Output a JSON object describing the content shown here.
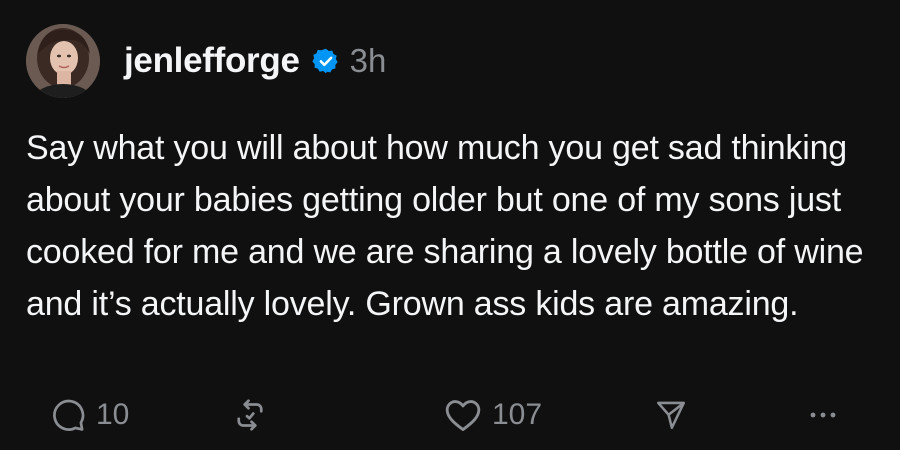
{
  "post": {
    "username": "jenlefforge",
    "timestamp": "3h",
    "verified": true,
    "text": "Say what you will about how much you get sad thinking about your babies getting older but one of my sons just cooked for me and we are sharing a lovely bottle of wine and it’s actually lovely. Grown ass kids are amazing.",
    "actions": {
      "reply_count": "10",
      "like_count": "107"
    }
  },
  "icons": {
    "avatar": "profile-photo",
    "verified": "verified-badge-icon",
    "reply": "comment-bubble-icon",
    "repost": "repost-arrows-icon",
    "like": "heart-icon",
    "share": "paper-plane-icon",
    "more": "ellipsis-icon"
  },
  "colors": {
    "background": "#101010",
    "text_primary": "#f3f5f7",
    "text_secondary": "#8a8d91",
    "verified_badge": "#0095f6"
  }
}
